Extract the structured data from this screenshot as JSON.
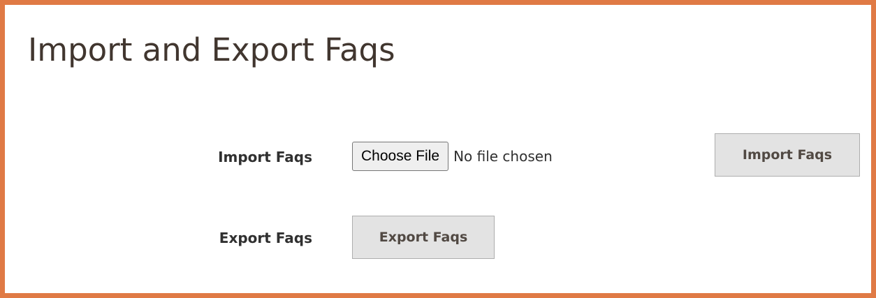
{
  "page": {
    "title": "Import and Export Faqs"
  },
  "import": {
    "label": "Import Faqs",
    "choose_file_label": "Choose File",
    "file_status": "No file chosen",
    "button_label": "Import Faqs"
  },
  "export": {
    "label": "Export Faqs",
    "button_label": "Export Faqs"
  },
  "colors": {
    "frame_border": "#e07a45",
    "button_background": "#e3e3e3",
    "text": "#303030"
  }
}
